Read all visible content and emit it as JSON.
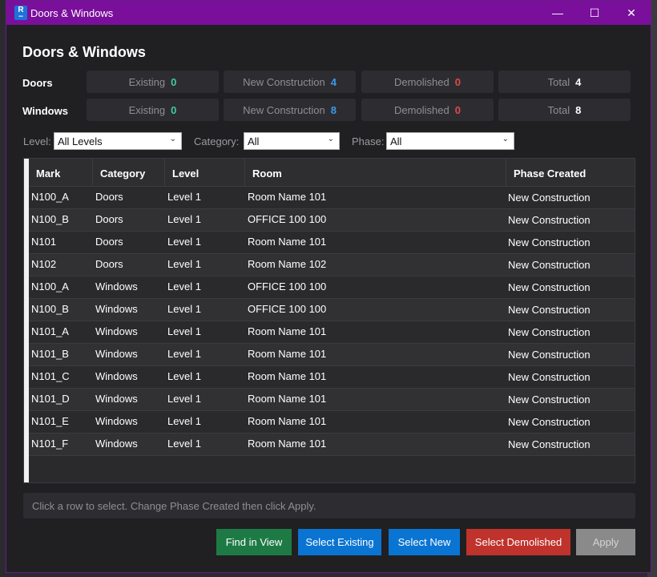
{
  "window": {
    "title": "Doors & Windows",
    "minimize": "—",
    "maximize": "☐",
    "close": "✕",
    "icon_text": "R"
  },
  "heading": "Doors & Windows",
  "summary": {
    "doors": {
      "label": "Doors",
      "existing_label": "Existing",
      "existing": "0",
      "new_label": "New Construction",
      "new": "4",
      "demolished_label": "Demolished",
      "demolished": "0",
      "total_label": "Total",
      "total": "4"
    },
    "windows": {
      "label": "Windows",
      "existing_label": "Existing",
      "existing": "0",
      "new_label": "New Construction",
      "new": "8",
      "demolished_label": "Demolished",
      "demolished": "0",
      "total_label": "Total",
      "total": "8"
    }
  },
  "filters": {
    "level_label": "Level:",
    "level_value": "All Levels",
    "category_label": "Category:",
    "category_value": "All",
    "phase_label": "Phase:",
    "phase_value": "All"
  },
  "table": {
    "columns": [
      "Mark",
      "Category",
      "Level",
      "Room",
      "Phase Created"
    ],
    "rows": [
      [
        "N100_A",
        "Doors",
        "Level 1",
        "Room Name 101",
        "New Construction"
      ],
      [
        "N100_B",
        "Doors",
        "Level 1",
        "OFFICE 100 100",
        "New Construction"
      ],
      [
        "N101",
        "Doors",
        "Level 1",
        "Room Name 101",
        "New Construction"
      ],
      [
        "N102",
        "Doors",
        "Level 1",
        "Room Name 102",
        "New Construction"
      ],
      [
        "N100_A",
        "Windows",
        "Level 1",
        "OFFICE 100 100",
        "New Construction"
      ],
      [
        "N100_B",
        "Windows",
        "Level 1",
        "OFFICE 100 100",
        "New Construction"
      ],
      [
        "N101_A",
        "Windows",
        "Level 1",
        "Room Name 101",
        "New Construction"
      ],
      [
        "N101_B",
        "Windows",
        "Level 1",
        "Room Name 101",
        "New Construction"
      ],
      [
        "N101_C",
        "Windows",
        "Level 1",
        "Room Name 101",
        "New Construction"
      ],
      [
        "N101_D",
        "Windows",
        "Level 1",
        "Room Name 101",
        "New Construction"
      ],
      [
        "N101_E",
        "Windows",
        "Level 1",
        "Room Name 101",
        "New Construction"
      ],
      [
        "N101_F",
        "Windows",
        "Level 1",
        "Room Name 101",
        "New Construction"
      ]
    ]
  },
  "status": "Click a row to select. Change Phase Created then click Apply.",
  "buttons": {
    "find": "Find in View",
    "select_existing": "Select Existing",
    "select_new": "Select New",
    "select_demolished": "Select Demolished",
    "apply": "Apply"
  },
  "colors": {
    "titlebar": "#7a0f9c",
    "existing": "#3fc9a0",
    "new": "#3d9be9",
    "demolished": "#e04848",
    "find_button": "#1e7a45",
    "select_button": "#0a74d2",
    "demolish_button": "#c0322c"
  }
}
